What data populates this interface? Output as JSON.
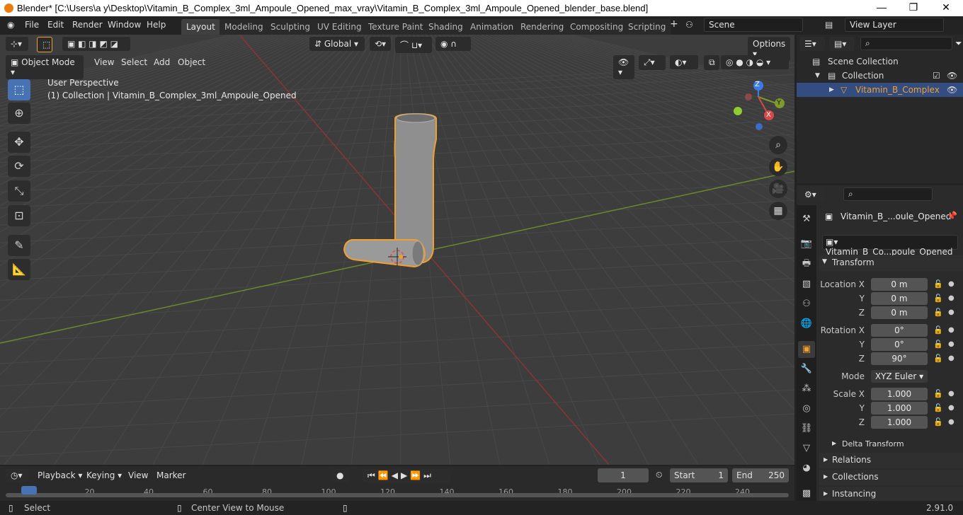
{
  "window": {
    "title": "Blender* [C:\\Users\\a y\\Desktop\\Vitamin_B_Complex_3ml_Ampoule_Opened_max_vray\\Vitamin_B_Complex_3ml_Ampoule_Opened_blender_base.blend]",
    "minimize": "—",
    "maximize": "❐",
    "close": "✕"
  },
  "menus": [
    "File",
    "Edit",
    "Render",
    "Window",
    "Help"
  ],
  "workspaces": [
    "Layout",
    "Modeling",
    "Sculpting",
    "UV Editing",
    "Texture Paint",
    "Shading",
    "Animation",
    "Rendering",
    "Compositing",
    "Scripting"
  ],
  "workspace_add": "+",
  "scene": "Scene",
  "view_layer": "View Layer",
  "viewport": {
    "mode": "Object Mode",
    "menu": [
      "View",
      "Select",
      "Add",
      "Object"
    ],
    "orientation": "Global",
    "options": "Options",
    "perspective": "User Perspective",
    "collection_info": "(1) Collection | Vitamin_B_Complex_3ml_Ampoule_Opened",
    "gizmo": {
      "z": "Z",
      "y": "Y",
      "x": "X"
    }
  },
  "outliner": {
    "scene_collection": "Scene Collection",
    "collection": "Collection",
    "object": "Vitamin_B_Complex"
  },
  "properties": {
    "object_name": "Vitamin_B_...oule_Opened",
    "data_name": "Vitamin_B_Co...poule_Opened",
    "transform": "Transform",
    "location_label": "Location X",
    "rotation_label": "Rotation X",
    "scale_label": "Scale X",
    "y": "Y",
    "z": "Z",
    "location": [
      "0 m",
      "0 m",
      "0 m"
    ],
    "rotation": [
      "0°",
      "0°",
      "90°"
    ],
    "mode_label": "Mode",
    "mode": "XYZ Euler",
    "scale": [
      "1.000",
      "1.000",
      "1.000"
    ],
    "delta": "Delta Transform",
    "relations": "Relations",
    "collections": "Collections",
    "instancing": "Instancing"
  },
  "timeline": {
    "menu": [
      "Playback",
      "Keying",
      "View",
      "Marker"
    ],
    "current_frame": "1",
    "start_label": "Start",
    "start": "1",
    "end_label": "End",
    "end": "250",
    "ticks": [
      "1",
      "20",
      "40",
      "60",
      "80",
      "100",
      "120",
      "140",
      "160",
      "180",
      "200",
      "220",
      "240"
    ]
  },
  "status": {
    "left": "Select",
    "middle": "Center View to Mouse",
    "version": "2.91.0"
  },
  "colors": {
    "accent": "#4772b3",
    "selection": "#f0a030",
    "x_axis": "#8b3434",
    "y_axis": "#6b8a2a"
  }
}
